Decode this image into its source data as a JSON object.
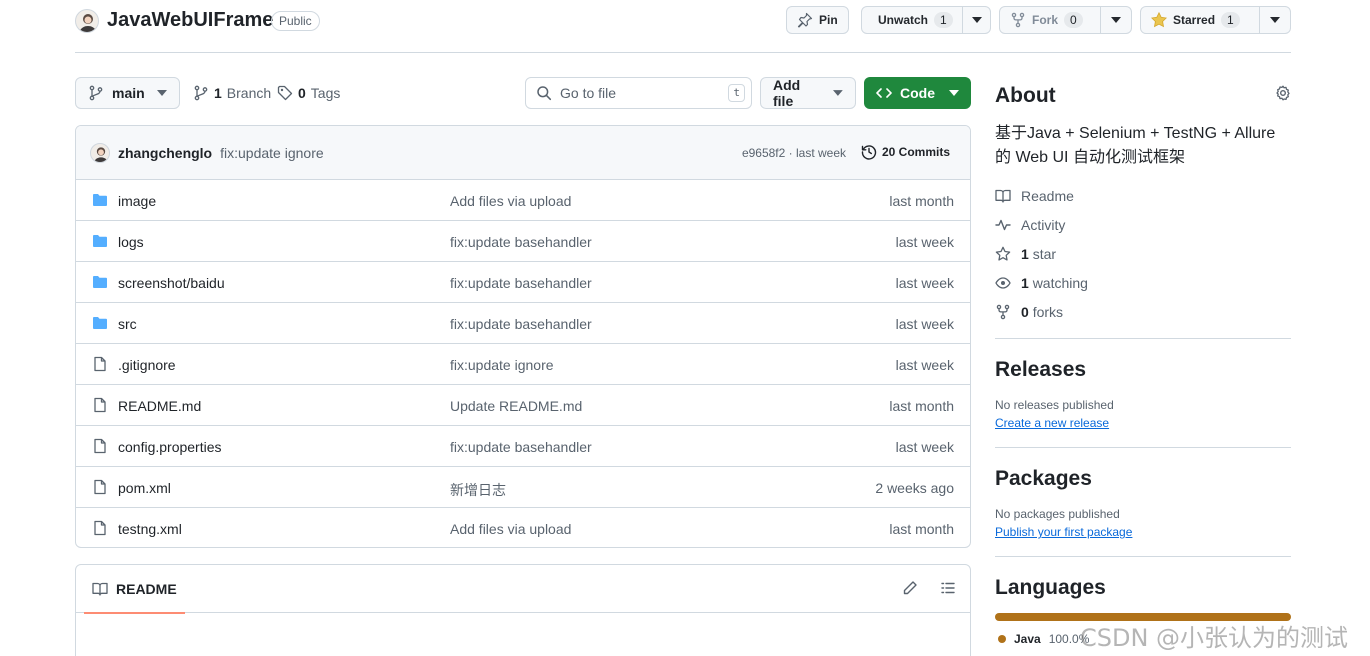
{
  "repo": {
    "name": "JavaWebUIFrame",
    "visibility": "Public"
  },
  "header_actions": {
    "pin_label": "Pin",
    "watch_label": "Unwatch",
    "watch_count": "1",
    "fork_label": "Fork",
    "fork_count": "0",
    "star_label": "Starred",
    "star_count": "1"
  },
  "nav": {
    "branch": "main",
    "branches_count": "1",
    "branches_label": "Branch",
    "tags_count": "0",
    "tags_label": "Tags",
    "search_placeholder": "Go to file",
    "search_shortcut": "t",
    "add_file_label": "Add file",
    "code_label": "Code"
  },
  "latest_commit": {
    "author": "zhangchenglo",
    "message": "fix:update ignore",
    "meta": "e9658f2 · last week",
    "commits_label": "20 Commits"
  },
  "files": [
    {
      "type": "dir",
      "name": "image",
      "message": "Add files via upload",
      "time": "last month"
    },
    {
      "type": "dir",
      "name": "logs",
      "message": "fix:update basehandler",
      "time": "last week"
    },
    {
      "type": "dir",
      "name": "screenshot/baidu",
      "message": "fix:update basehandler",
      "time": "last week"
    },
    {
      "type": "dir",
      "name": "src",
      "message": "fix:update basehandler",
      "time": "last week"
    },
    {
      "type": "file",
      "name": ".gitignore",
      "message": "fix:update ignore",
      "time": "last week"
    },
    {
      "type": "file",
      "name": "README.md",
      "message": "Update README.md",
      "time": "last month"
    },
    {
      "type": "file",
      "name": "config.properties",
      "message": "fix:update basehandler",
      "time": "last week"
    },
    {
      "type": "file",
      "name": "pom.xml",
      "message": "新增日志",
      "time": "2 weeks ago"
    },
    {
      "type": "file",
      "name": "testng.xml",
      "message": "Add files via upload",
      "time": "last month"
    }
  ],
  "readme": {
    "tab_label": "README"
  },
  "about": {
    "title": "About",
    "description": "基于Java + Selenium + TestNG + Allure 的 Web UI 自动化测试框架",
    "links": [
      {
        "icon": "book-icon",
        "strong": "",
        "label": "Readme"
      },
      {
        "icon": "pulse-icon",
        "strong": "",
        "label": "Activity"
      },
      {
        "icon": "star-icon",
        "strong": "1",
        "label": "star"
      },
      {
        "icon": "eye-icon",
        "strong": "1",
        "label": "watching"
      },
      {
        "icon": "fork-icon",
        "strong": "0",
        "label": "forks"
      }
    ]
  },
  "releases": {
    "title": "Releases",
    "empty_text": "No releases published",
    "create_link": "Create a new release"
  },
  "packages": {
    "title": "Packages",
    "empty_text": "No packages published",
    "publish_link": "Publish your first package"
  },
  "languages": {
    "title": "Languages",
    "items": [
      {
        "name": "Java",
        "percent": "100.0%",
        "share": 1.0,
        "color": "#b07219"
      }
    ]
  },
  "watermark": "CSDN @小张认为的测试"
}
